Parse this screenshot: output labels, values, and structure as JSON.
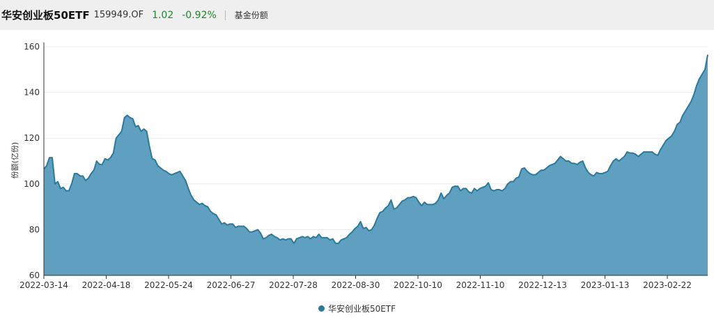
{
  "header": {
    "fund_name": "华安创业板50ETF",
    "fund_code": "159949.OF",
    "price": "1.02",
    "change": "-0.92%",
    "metric_label": "基金份额"
  },
  "colors": {
    "line": "#2a7a9b",
    "fill": "#5f9fbf",
    "up_down": "#1a8a2a"
  },
  "chart_data": {
    "type": "area",
    "ylabel": "份额(亿份)",
    "ylim": [
      60,
      160
    ],
    "yticks": [
      60,
      80,
      100,
      120,
      140,
      160
    ],
    "xticks": [
      "2022-03-14",
      "2022-04-18",
      "2022-05-24",
      "2022-06-27",
      "2022-07-28",
      "2022-08-30",
      "2022-10-10",
      "2022-11-10",
      "2022-12-13",
      "2023-01-13",
      "2023-02-22"
    ],
    "grid": "horizontal",
    "legend": "bottom-center",
    "series": [
      {
        "name": "华安创业板50ETF",
        "values": [
          106.5,
          108,
          111.5,
          111.5,
          100,
          101,
          98,
          98.5,
          97,
          97,
          100,
          104.5,
          104.5,
          103.5,
          103.5,
          101.5,
          102.5,
          104.5,
          106,
          110,
          108.5,
          108.5,
          111,
          110.5,
          111.5,
          113.5,
          120,
          121.5,
          123,
          129,
          130,
          129,
          128.5,
          125,
          125.5,
          123,
          124,
          123,
          116.5,
          111,
          110.5,
          108,
          107,
          106,
          105.5,
          104.5,
          104,
          104.5,
          105,
          105.5,
          103.5,
          101.5,
          98,
          95,
          93,
          92,
          91,
          91.5,
          90.5,
          90,
          88,
          87,
          86.5,
          84.5,
          82.5,
          83,
          82,
          82.5,
          82.5,
          81,
          81.5,
          81.5,
          81.5,
          80.5,
          79,
          79,
          79.5,
          80,
          78.5,
          76,
          76.5,
          77.5,
          78,
          77,
          76.5,
          75.5,
          76,
          75.5,
          76,
          76,
          74,
          76,
          76.5,
          77,
          76.5,
          77,
          76,
          77,
          76.5,
          78,
          76.5,
          76.5,
          76.5,
          75.5,
          76,
          74,
          74,
          75.5,
          76,
          76.5,
          78,
          79,
          80.5,
          81.5,
          83.5,
          80.5,
          81,
          79.5,
          80,
          82,
          85,
          87.5,
          88,
          89.5,
          90.5,
          93,
          89,
          89.5,
          91,
          92.5,
          93,
          94,
          94,
          94.5,
          94,
          92,
          90.5,
          92,
          91,
          91,
          91,
          91.5,
          93,
          96,
          93.5,
          95,
          96,
          98.5,
          99,
          99,
          97,
          98,
          98,
          96.5,
          96,
          98,
          97,
          98,
          98.5,
          99,
          100.5,
          97.5,
          97,
          97.5,
          97.5,
          97,
          98,
          100,
          101,
          101,
          102.5,
          103,
          106.5,
          107,
          105.5,
          104.5,
          104,
          104,
          105,
          106,
          106,
          107,
          108,
          108.5,
          109,
          110.5,
          112,
          111,
          110,
          110,
          109,
          109,
          108.5,
          109.5,
          110,
          107,
          105,
          104,
          103.5,
          105,
          104.5,
          104.5,
          105,
          105.5,
          108,
          110,
          111,
          110,
          111,
          112,
          114,
          113.5,
          113.5,
          113,
          112,
          113,
          114,
          114,
          114,
          114,
          113,
          112.5,
          115,
          117,
          119,
          120,
          121,
          123,
          126,
          127,
          130,
          132,
          134,
          136,
          139,
          143,
          146,
          148,
          150,
          156.5
        ]
      }
    ]
  }
}
